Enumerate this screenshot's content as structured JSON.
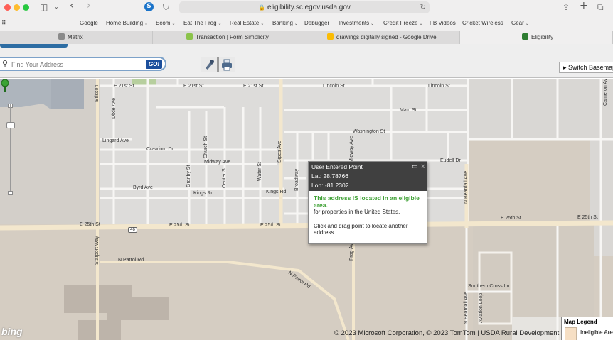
{
  "browser": {
    "url": "eligibility.sc.egov.usda.gov",
    "bookmarks": [
      {
        "label": "Google",
        "menu": false
      },
      {
        "label": "Home Building",
        "menu": true
      },
      {
        "label": "Ecom",
        "menu": true
      },
      {
        "label": "Eat The Frog",
        "menu": true
      },
      {
        "label": "Real Estate",
        "menu": true
      },
      {
        "label": "Banking",
        "menu": true
      },
      {
        "label": "Debugger",
        "menu": false
      },
      {
        "label": "Investments",
        "menu": true
      },
      {
        "label": "Credit Freeze",
        "menu": true
      },
      {
        "label": "FB Videos",
        "menu": false
      },
      {
        "label": "Cricket Wireless",
        "menu": false
      },
      {
        "label": "Gear",
        "menu": true
      }
    ],
    "tabs": [
      {
        "label": "Matrix",
        "icon_color": "#8a8a8a",
        "icon_letter": "M"
      },
      {
        "label": "Transaction | Form Simplicity",
        "icon_color": "#8bc34a",
        "icon_letter": ""
      },
      {
        "label": "drawings digitally signed - Google Drive",
        "icon_color": "#fbbc04",
        "icon_letter": ""
      },
      {
        "label": "Eligibility",
        "icon_color": "#2e7d32",
        "icon_letter": ""
      }
    ],
    "active_tab_index": 3
  },
  "app": {
    "search_placeholder": "Find Your Address",
    "go_label": "GO!",
    "switch_basemap_label": "Switch Basemap",
    "accent_color": "#1c4f9c"
  },
  "map": {
    "labels": {
      "e21_a": "E 21st St",
      "e21_b": "E 21st St",
      "e21_c": "E 21st St",
      "lincoln": "Lincoln St",
      "lincoln_b": "Lincoln St",
      "main": "Main St",
      "washington": "Washington St",
      "lingard": "Lingard Ave",
      "crawford": "Crawford Dr",
      "midway": "Midway Ave",
      "eudell": "Eudell Dr",
      "byrd": "Byrd Ave",
      "kings_a": "Kings Rd",
      "kings_b": "Kings Rd",
      "e25_a": "E 25th St",
      "e25_b": "E 25th St",
      "e25_c": "E 25th St",
      "e25_d": "E 25th St",
      "e25_e": "E 25th St",
      "npatrol_a": "N Patrol Rd",
      "npatrol_b": "N Patrol Rd",
      "southern": "Southern Cross Ln",
      "brisson": "Brisson",
      "dixie": "Dixie Ave",
      "granby": "Granby St",
      "church": "Church St",
      "center": "Center St",
      "water": "Water St",
      "sipes": "Sipes Ave",
      "broadway": "Broadway",
      "midway_v": "Midway Ave",
      "nbeardall": "N Beardall Ave",
      "starport": "Starport Way",
      "frog": "Frog Ave",
      "nbeardall2": "N Beardall Ave",
      "aviation": "Aviation Loop",
      "cameron": "Cameron Av",
      "route_46": "46"
    },
    "popup": {
      "title": "User Entered Point",
      "lat": "Lat: 28.78766",
      "lon": "Lon: -81.2302",
      "eligible_text": "This address IS located in an eligible area.",
      "scope_text": "for properties in the United States.",
      "instruction_text": "Click and drag point to locate another address."
    },
    "copyright": "© 2023 Microsoft Corporation, © 2023 TomTom | USDA Rural Development",
    "bing_logo": "bing",
    "legend": {
      "title": "Map Legend",
      "item": "Ineligible Area",
      "item_color": "#f6dfc4"
    }
  }
}
